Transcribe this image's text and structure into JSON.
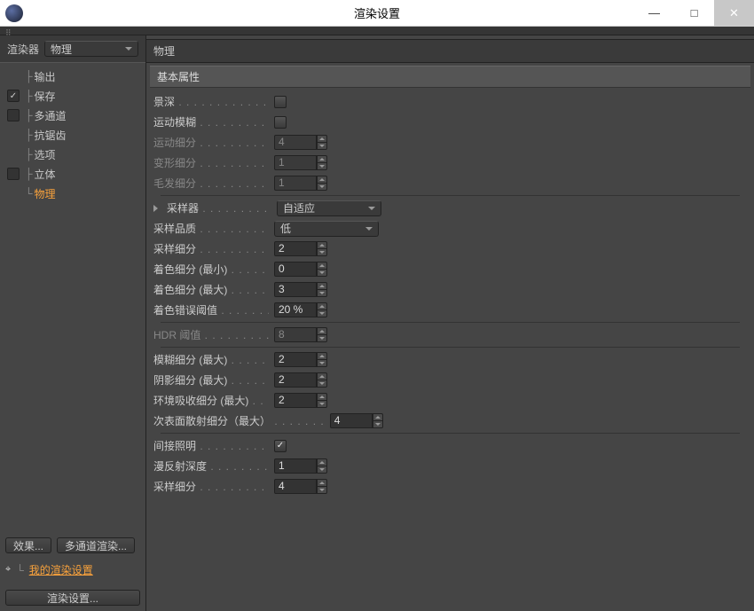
{
  "window": {
    "title": "渲染设置",
    "minimize": "—",
    "maximize": "□",
    "close": "✕"
  },
  "renderer": {
    "label": "渲染器",
    "value": "物理"
  },
  "tree": {
    "items": [
      {
        "label": "输出",
        "check": ""
      },
      {
        "label": "保存",
        "check": "✓"
      },
      {
        "label": "多通道",
        "check": ""
      },
      {
        "label": "抗锯齿",
        "check": null
      },
      {
        "label": "选项",
        "check": null
      },
      {
        "label": "立体",
        "check": ""
      },
      {
        "label": "物理",
        "check": null,
        "active": true
      }
    ]
  },
  "buttons": {
    "effects": "效果...",
    "multipass": "多通道渲染...",
    "my_settings_label": "我的渲染设置",
    "render_settings": "渲染设置..."
  },
  "panel": {
    "title": "物理",
    "group_basic": "基本属性",
    "dof": {
      "label": "景深",
      "checked": false
    },
    "motion_blur": {
      "label": "运动模糊",
      "checked": false
    },
    "motion_sub": {
      "label": "运动细分",
      "value": "4",
      "disabled": true
    },
    "deform_sub": {
      "label": "变形细分",
      "value": "1",
      "disabled": true
    },
    "hair_sub": {
      "label": "毛发细分",
      "value": "1",
      "disabled": true
    },
    "sampler": {
      "label": "采样器",
      "value": "自适应"
    },
    "sample_quality": {
      "label": "采样品质",
      "value": "低"
    },
    "sample_sub": {
      "label": "采样细分",
      "value": "2"
    },
    "shading_min": {
      "label": "着色细分 (最小)",
      "value": "0"
    },
    "shading_max": {
      "label": "着色细分 (最大)",
      "value": "3"
    },
    "shading_err": {
      "label": "着色错误阈值",
      "value": "20 %"
    },
    "hdr_thresh": {
      "label": "HDR 阈值",
      "value": "8",
      "disabled": true
    },
    "blur_max": {
      "label": "模糊细分 (最大)",
      "value": "2"
    },
    "shadow_max": {
      "label": "阴影细分 (最大)",
      "value": "2"
    },
    "ao_max": {
      "label": "环境吸收细分 (最大)",
      "value": "2"
    },
    "sss_max": {
      "label": "次表面散射细分（最大）",
      "value": "4"
    },
    "indirect": {
      "label": "间接照明",
      "checked": true
    },
    "diffuse_depth": {
      "label": "漫反射深度",
      "value": "1"
    },
    "sample_sub2": {
      "label": "采样细分",
      "value": "4"
    }
  }
}
